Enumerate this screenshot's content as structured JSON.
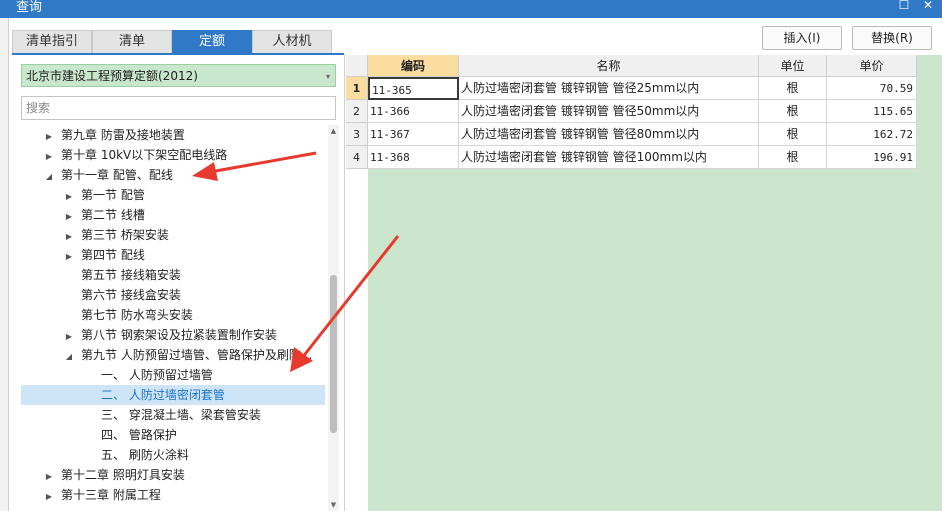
{
  "window": {
    "title": "查询",
    "restore_glyph": "☐",
    "close_glyph": "✕"
  },
  "tabs": [
    {
      "label": "清单指引",
      "active": false
    },
    {
      "label": "清单",
      "active": false
    },
    {
      "label": "定额",
      "active": true
    },
    {
      "label": "人材机",
      "active": false
    }
  ],
  "toolbar": {
    "insert_label": "插入(I)",
    "replace_label": "替换(R)"
  },
  "quota_library": {
    "selected": "北京市建设工程预算定额(2012)",
    "caret_icon": "▾"
  },
  "search": {
    "placeholder": "搜索",
    "value": ""
  },
  "tree": {
    "collapsed_icon": "▶",
    "expanded_icon": "◢",
    "items": [
      {
        "label": "第九章 防雷及接地装置",
        "level": 1,
        "toggle": "collapsed",
        "selected": false
      },
      {
        "label": "第十章 10kV以下架空配电线路",
        "level": 1,
        "toggle": "collapsed",
        "selected": false
      },
      {
        "label": "第十一章 配管、配线",
        "level": 1,
        "toggle": "expanded",
        "selected": false
      },
      {
        "label": "第一节 配管",
        "level": 2,
        "toggle": "collapsed",
        "selected": false
      },
      {
        "label": "第二节 线槽",
        "level": 2,
        "toggle": "collapsed",
        "selected": false
      },
      {
        "label": "第三节 桥架安装",
        "level": 2,
        "toggle": "collapsed",
        "selected": false
      },
      {
        "label": "第四节 配线",
        "level": 2,
        "toggle": "collapsed",
        "selected": false
      },
      {
        "label": "第五节 接线箱安装",
        "level": 2,
        "toggle": "none",
        "selected": false
      },
      {
        "label": "第六节 接线盒安装",
        "level": 2,
        "toggle": "none",
        "selected": false
      },
      {
        "label": "第七节 防水弯头安装",
        "level": 2,
        "toggle": "none",
        "selected": false
      },
      {
        "label": "第八节 钢索架设及拉紧装置制作安装",
        "level": 2,
        "toggle": "collapsed",
        "selected": false
      },
      {
        "label": "第九节 人防预留过墙管、管路保护及刷防...",
        "level": 2,
        "toggle": "expanded",
        "selected": false
      },
      {
        "label": "一、 人防预留过墙管",
        "level": 3,
        "toggle": "none",
        "selected": false
      },
      {
        "label": "二、 人防过墙密闭套管",
        "level": 3,
        "toggle": "none",
        "selected": true
      },
      {
        "label": "三、 穿混凝土墙、梁套管安装",
        "level": 3,
        "toggle": "none",
        "selected": false
      },
      {
        "label": "四、 管路保护",
        "level": 3,
        "toggle": "none",
        "selected": false
      },
      {
        "label": "五、 刷防火涂料",
        "level": 3,
        "toggle": "none",
        "selected": false
      },
      {
        "label": "第十二章 照明灯具安装",
        "level": 1,
        "toggle": "collapsed",
        "selected": false
      },
      {
        "label": "第十三章 附属工程",
        "level": 1,
        "toggle": "collapsed",
        "selected": false
      }
    ]
  },
  "scrollbar": {
    "up_icon": "▲",
    "down_icon": "▼"
  },
  "grid": {
    "columns": [
      "编码",
      "名称",
      "单位",
      "单价"
    ],
    "rows": [
      {
        "num": "1",
        "code": "11-365",
        "name": "人防过墙密闭套管 镀锌钢管 管径25mm以内",
        "unit": "根",
        "price": "70.59"
      },
      {
        "num": "2",
        "code": "11-366",
        "name": "人防过墙密闭套管 镀锌钢管 管径50mm以内",
        "unit": "根",
        "price": "115.65"
      },
      {
        "num": "3",
        "code": "11-367",
        "name": "人防过墙密闭套管 镀锌钢管 管径80mm以内",
        "unit": "根",
        "price": "162.72"
      },
      {
        "num": "4",
        "code": "11-368",
        "name": "人防过墙密闭套管 镀锌钢管 管径100mm以内",
        "unit": "根",
        "price": "196.91"
      }
    ]
  },
  "colors": {
    "accent": "#2f79c7",
    "grid_bg": "#cbe6cd",
    "annotation_arrow": "#e8392d",
    "selection": "#cde5f7",
    "header_highlight": "#fbdda0"
  }
}
